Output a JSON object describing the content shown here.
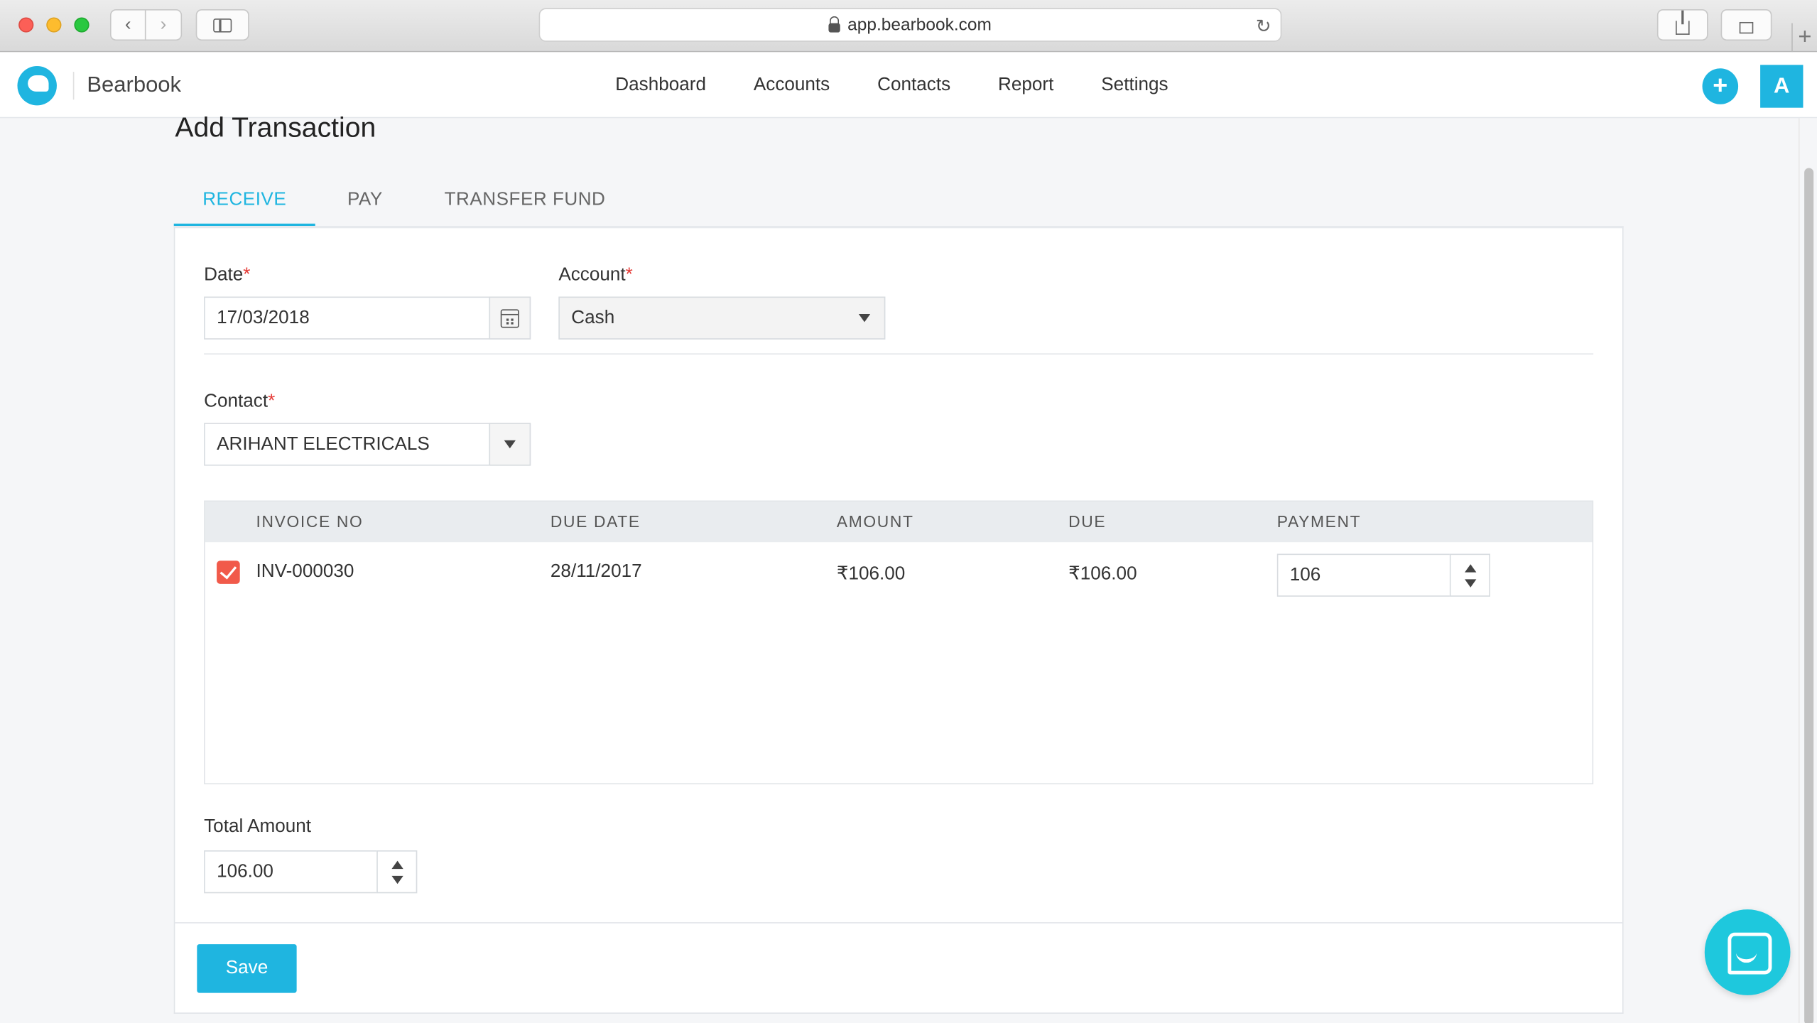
{
  "browser": {
    "url": "app.bearbook.com"
  },
  "app": {
    "brand": "Bearbook",
    "nav": [
      "Dashboard",
      "Accounts",
      "Contacts",
      "Report",
      "Settings"
    ],
    "add_label": "+",
    "avatar_initial": "A",
    "accent_color": "#1fb5e0"
  },
  "page": {
    "title": "Add Transaction",
    "tabs": [
      {
        "label": "RECEIVE",
        "active": true
      },
      {
        "label": "PAY",
        "active": false
      },
      {
        "label": "TRANSFER FUND",
        "active": false
      }
    ]
  },
  "form": {
    "date_label": "Date",
    "date_value": "17/03/2018",
    "account_label": "Account",
    "account_value": "Cash",
    "contact_label": "Contact",
    "contact_value": "ARIHANT ELECTRICALS",
    "required_mark": "*",
    "total_label": "Total Amount",
    "total_value": "106.00",
    "save_label": "Save"
  },
  "invoices": {
    "headers": [
      "INVOICE NO",
      "DUE DATE",
      "AMOUNT",
      "DUE",
      "PAYMENT"
    ],
    "rows": [
      {
        "checked": true,
        "invoice_no": "INV-000030",
        "due_date": "28/11/2017",
        "amount": "₹106.00",
        "due": "₹106.00",
        "payment": "106"
      }
    ]
  },
  "icons": {
    "calendar": "calendar-icon",
    "dropdown": "chevron-down-icon",
    "chat": "chat-icon"
  }
}
